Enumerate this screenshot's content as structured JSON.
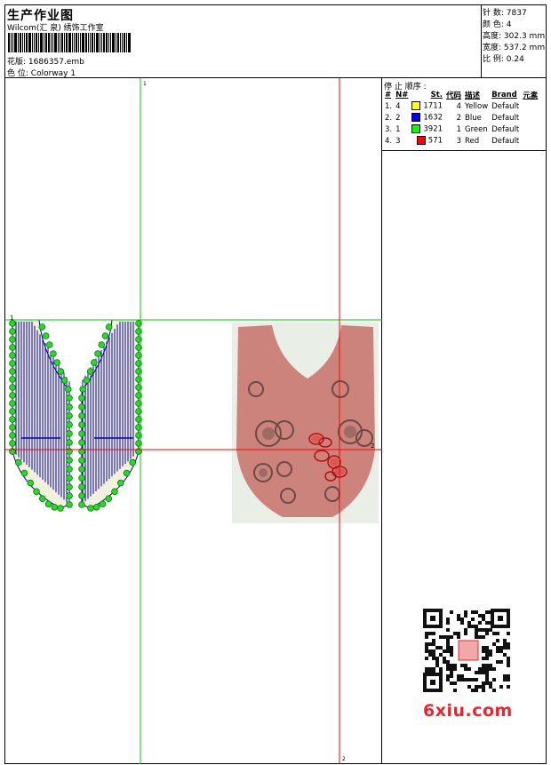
{
  "header": {
    "title": "生产作业图",
    "subtitle": "Wilcom(汇 泉) 绣饰工作室",
    "design_label": "花版:",
    "design_value": "1686357.emb",
    "colorway_label": "色 位:",
    "colorway_value": "Colorway 1"
  },
  "stats": {
    "stitches_label": "针 数:",
    "stitches_value": "7837",
    "colors_label": "颜 色:",
    "colors_value": "4",
    "height_label": "高度:",
    "height_value": "302.3 mm",
    "width_label": "宽度:",
    "width_value": "537.2 mm",
    "scale_label": "比 例:",
    "scale_value": "0.24"
  },
  "stop_sequence": {
    "title": "停 止 顺序 :",
    "headers": [
      "#",
      "N#",
      "St.",
      "代码",
      "描述",
      "Brand",
      "元素"
    ],
    "rows": [
      {
        "idx": "1.",
        "n": "4",
        "st": "1711",
        "code": "4",
        "desc": "Yellow",
        "brand": "Default",
        "color": "#ffff00"
      },
      {
        "idx": "2.",
        "n": "2",
        "st": "1632",
        "code": "2",
        "desc": "Blue",
        "brand": "Default",
        "color": "#0000ff"
      },
      {
        "idx": "3.",
        "n": "1",
        "st": "3921",
        "code": "1",
        "desc": "Green",
        "brand": "Default",
        "color": "#00ff00"
      },
      {
        "idx": "4.",
        "n": "3",
        "st": "571",
        "code": "3",
        "desc": "Red",
        "brand": "Default",
        "color": "#ff0000"
      }
    ]
  },
  "canvas_marks": {
    "top_left": "1",
    "right_mid": "2",
    "bottom": "2",
    "left_top": "1"
  },
  "watermark": {
    "text": "6xiu.com"
  },
  "colors": {
    "guide_green": "#00cc00",
    "guide_red": "#ff0000",
    "stitch_blue": "#0000aa",
    "lace_pink": "#c97a72",
    "brand_red": "#e8262d"
  }
}
